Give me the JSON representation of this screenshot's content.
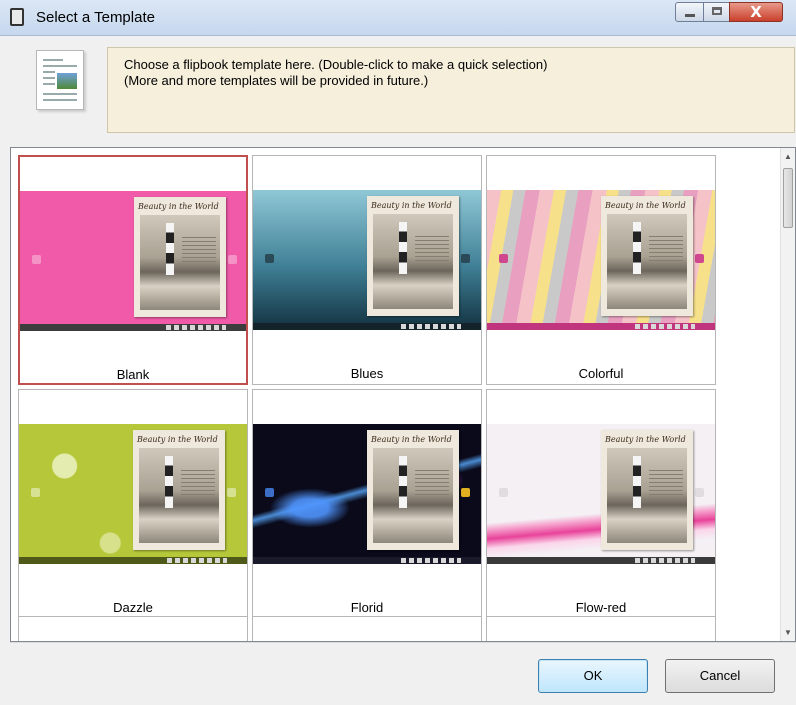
{
  "window": {
    "title": "Select a Template",
    "close_glyph": "X"
  },
  "info": {
    "line1": "Choose a flipbook template here. (Double-click to make a quick selection)",
    "line2": "(More and more templates will be provided in future.)"
  },
  "book_title": "Beauty in the World",
  "templates": [
    {
      "name": "Blank",
      "selected": true
    },
    {
      "name": "Blues",
      "selected": false
    },
    {
      "name": "Colorful",
      "selected": false
    },
    {
      "name": "Dazzle",
      "selected": false
    },
    {
      "name": "Florid",
      "selected": false
    },
    {
      "name": "Flow-red",
      "selected": false
    }
  ],
  "buttons": {
    "ok": "OK",
    "cancel": "Cancel"
  },
  "colors": {
    "blank": "#f05aa8",
    "blues": "#3f7f95",
    "colorful": "#f5c2c8",
    "dazzle": "#b6c83a",
    "florid": "#0a0a1a",
    "flow_red": "#f4f0f4",
    "selected_border": "#c0504d"
  },
  "icons": {
    "window": "template-window-icon",
    "info": "document-icon"
  }
}
